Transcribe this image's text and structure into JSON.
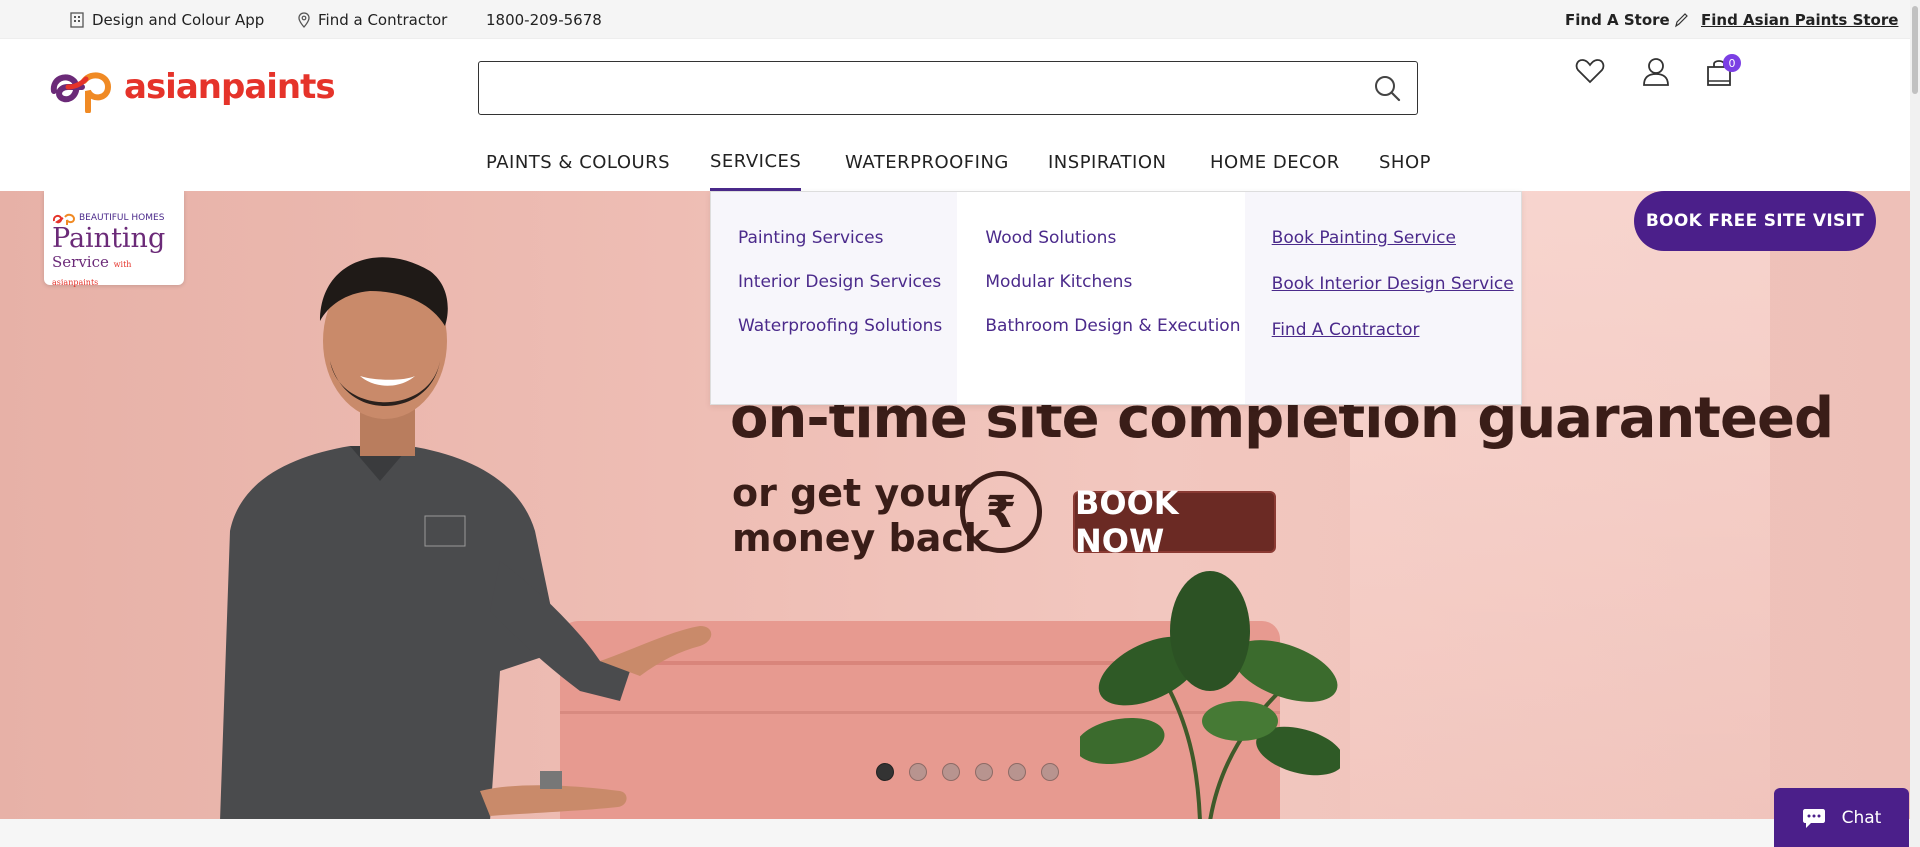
{
  "topbar": {
    "design_app": "Design and Colour App",
    "find_contractor": "Find a Contractor",
    "phone": "1800-209-5678",
    "find_store": "Find A Store",
    "find_ap_store": "Find Asian Paints Store"
  },
  "header": {
    "logo_text": "asianpaints",
    "search_placeholder": "",
    "cart_count": "0"
  },
  "nav": {
    "items": [
      "PAINTS & COLOURS",
      "SERVICES",
      "WATERPROOFING",
      "INSPIRATION",
      "HOME DECOR",
      "SHOP"
    ],
    "active": "SERVICES"
  },
  "services_menu": {
    "col1": [
      "Painting Services",
      "Interior Design Services",
      "Waterproofing Solutions"
    ],
    "col2": [
      "Wood Solutions",
      "Modular Kitchens",
      "Bathroom Design & Execution"
    ],
    "col3": [
      "Book Painting Service",
      "Book Interior Design Service",
      "Find A Contractor"
    ]
  },
  "hero": {
    "badge_top": "BEAUTIFUL HOMES",
    "badge_line1": "Painting",
    "badge_line2": "Service",
    "badge_small": "with asianpaints",
    "headline": "on-time site completion guaranteed",
    "sub_line1": "or get your",
    "sub_line2": "money back",
    "rupee": "₹",
    "book_now": "BOOK NOW",
    "book_free_visit": "BOOK FREE SITE VISIT",
    "slide_count": 6,
    "active_slide": 1
  },
  "chat": {
    "label": "Chat"
  },
  "colors": {
    "brand_purple": "#4b1f8a",
    "brand_red": "#e5332a",
    "link_purple": "#4b2a8b"
  }
}
